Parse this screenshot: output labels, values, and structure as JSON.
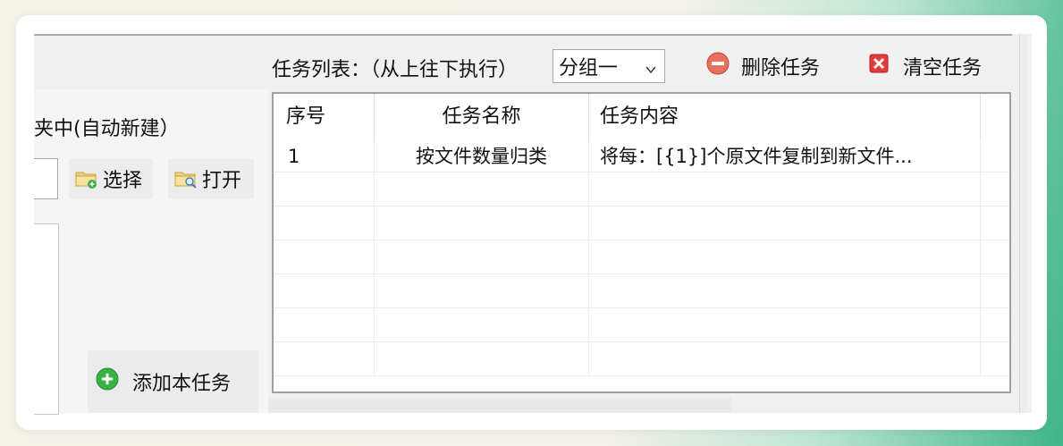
{
  "left": {
    "folder_label": "夹中(自动新建）",
    "path_value": "",
    "select_label": "选择",
    "open_label": "打开",
    "add_task_label": "添加本任务"
  },
  "toolbar": {
    "task_list_title": "任务列表：（从上往下执行）",
    "group_selected": "分组一",
    "delete_label": "删除任务",
    "clear_label": "清空任务"
  },
  "table": {
    "headers": [
      "序号",
      "任务名称",
      "任务内容"
    ],
    "rows": [
      {
        "index": "1",
        "name": "按文件数量归类",
        "content": "将每：[{1}]个原文件复制到新文件..."
      }
    ]
  },
  "colors": {
    "delete_icon": "#e05a4a",
    "clear_icon": "#e03030",
    "add_icon": "#3db04a"
  },
  "icons": [
    "folder-add-icon",
    "folder-search-icon",
    "add-circle-icon",
    "minus-circle-icon",
    "close-square-icon",
    "chevron-down-icon"
  ]
}
